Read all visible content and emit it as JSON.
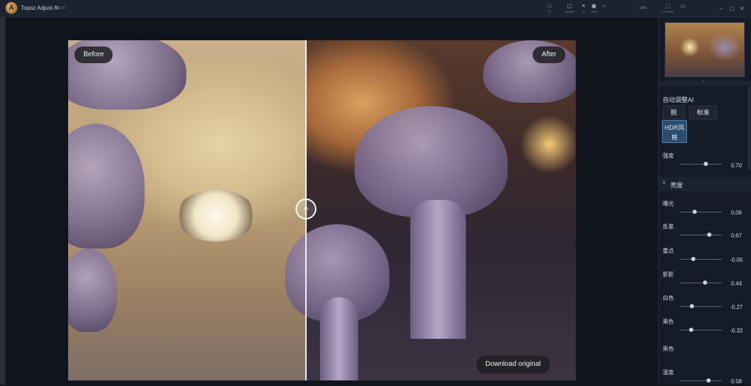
{
  "app": {
    "title": "Topaz Adjust AI",
    "badge": "BETA"
  },
  "toolbar": {
    "tools": [
      {
        "icon": "□",
        "label": "Fit"
      },
      {
        "icon": "▢",
        "label": "Original"
      },
      {
        "icon": "✕",
        "label": "Fit"
      },
      {
        "icon": "▣",
        "label": "Split"
      },
      {
        "icon": "○",
        "label": ""
      }
    ],
    "zoom": "23%",
    "preview_label": "4 Preview"
  },
  "canvas": {
    "before_label": "Before",
    "after_label": "After",
    "download_label": "Download original",
    "split_fraction": 0.468
  },
  "panel": {
    "auto_section": "自动调整AI",
    "modes": [
      "脱",
      "标准",
      "HDR风格"
    ],
    "active_mode": "HDR风格",
    "strength": {
      "label": "强度",
      "value": "0.70",
      "position": 0.62
    },
    "brightness_group": "亮度",
    "controls": [
      {
        "label": "曝光",
        "value": "0.06",
        "position": 0.35
      },
      {
        "label": "反差",
        "value": "0.67",
        "position": 0.7
      },
      {
        "label": "重点",
        "value": "-0.05",
        "position": 0.32
      },
      {
        "label": "影影",
        "value": "0.44",
        "position": 0.6
      },
      {
        "label": "白色",
        "value": "-0.27",
        "position": 0.28
      },
      {
        "label": "黑色",
        "value": "-0.32",
        "position": 0.27
      },
      {
        "label": "黑色",
        "value": "",
        "position": null
      },
      {
        "label": "温度",
        "value": "0.58",
        "position": 0.68
      }
    ]
  }
}
